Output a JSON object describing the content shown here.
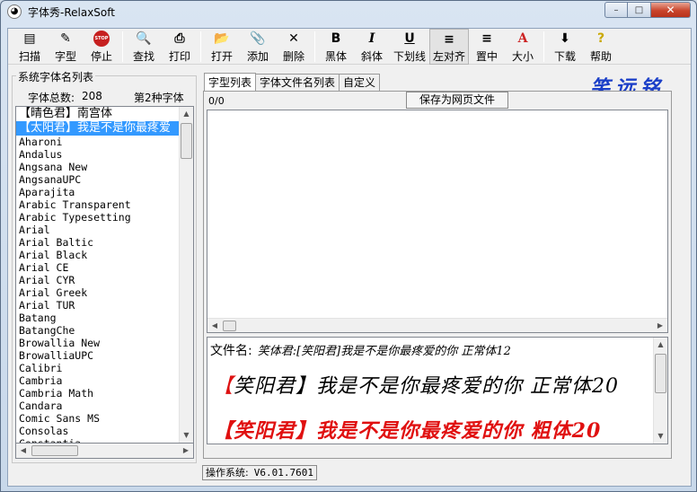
{
  "window": {
    "title": "字体秀-RelaxSoft",
    "controls": {
      "minimize": "–",
      "maximize": "□",
      "close": "✕"
    }
  },
  "toolbar": [
    {
      "label": "扫描",
      "icon": "scanner-icon",
      "glyph": "▤"
    },
    {
      "label": "字型",
      "icon": "fonts-icon",
      "glyph": "✎"
    },
    {
      "label": "停止",
      "icon": "stop-icon",
      "glyph": "STOP"
    },
    {
      "label": "查找",
      "icon": "find-icon",
      "glyph": "🔍"
    },
    {
      "label": "打印",
      "icon": "printer-icon",
      "glyph": "⎙"
    },
    {
      "label": "打开",
      "icon": "open-folder-icon",
      "glyph": "📂"
    },
    {
      "label": "添加",
      "icon": "paperclip-icon",
      "glyph": "📎"
    },
    {
      "label": "删除",
      "icon": "delete-icon",
      "glyph": "✕"
    },
    {
      "label": "黑体",
      "icon": "bold-icon",
      "glyph": "B"
    },
    {
      "label": "斜体",
      "icon": "italic-icon",
      "glyph": "I"
    },
    {
      "label": "下划线",
      "icon": "underline-icon",
      "glyph": "U"
    },
    {
      "label": "左对齐",
      "icon": "align-left-icon",
      "glyph": "≡"
    },
    {
      "label": "置中",
      "icon": "align-center-icon",
      "glyph": "≡"
    },
    {
      "label": "大小",
      "icon": "font-size-icon",
      "glyph": "A"
    },
    {
      "label": "下载",
      "icon": "download-icon",
      "glyph": "⬇"
    },
    {
      "label": "帮助",
      "icon": "help-icon",
      "glyph": "?"
    }
  ],
  "left_panel": {
    "group_title": "系统字体名列表",
    "count_label": "字体总数:",
    "count_value": "208",
    "current_label": "第2种字体",
    "fonts": [
      "【晴色君】南宫体",
      "【太阳君】我是不是你最疼爱",
      "Aharoni",
      "Andalus",
      "Angsana New",
      "AngsanaUPC",
      "Aparajita",
      "Arabic Transparent",
      "Arabic Typesetting",
      "Arial",
      "Arial Baltic",
      "Arial Black",
      "Arial CE",
      "Arial CYR",
      "Arial Greek",
      "Arial TUR",
      "Batang",
      "BatangChe",
      "Browallia New",
      "BrowalliaUPC",
      "Calibri",
      "Cambria",
      "Cambria Math",
      "Candara",
      "Comic Sans MS",
      "Consolas",
      "Constantia"
    ],
    "selected_index": 1
  },
  "tabs": [
    "字型列表",
    "字体文件名列表",
    "自定义"
  ],
  "active_tab": 0,
  "brand_text": "笑远铭",
  "counter": "0/0",
  "save_button": "保存为网页文件",
  "preview": {
    "filename_label": "文件名:",
    "filename_value": "笑体君:[笑阳君]我是不是你最疼爱的你 正常体12",
    "sample_normal_prefix": "【",
    "sample_normal_name": "笑阳君",
    "sample_normal_suffix": "】我是不是你最疼爱的你 正常体20",
    "sample_bold": "【笑阳君】我是不是你最疼爱的你 粗体20"
  },
  "status": {
    "label": "操作系统:",
    "version": "V6.01.7601"
  },
  "colors": {
    "selection": "#3399ff",
    "brand": "#1b3fc8",
    "bold_sample": "#e01010"
  }
}
